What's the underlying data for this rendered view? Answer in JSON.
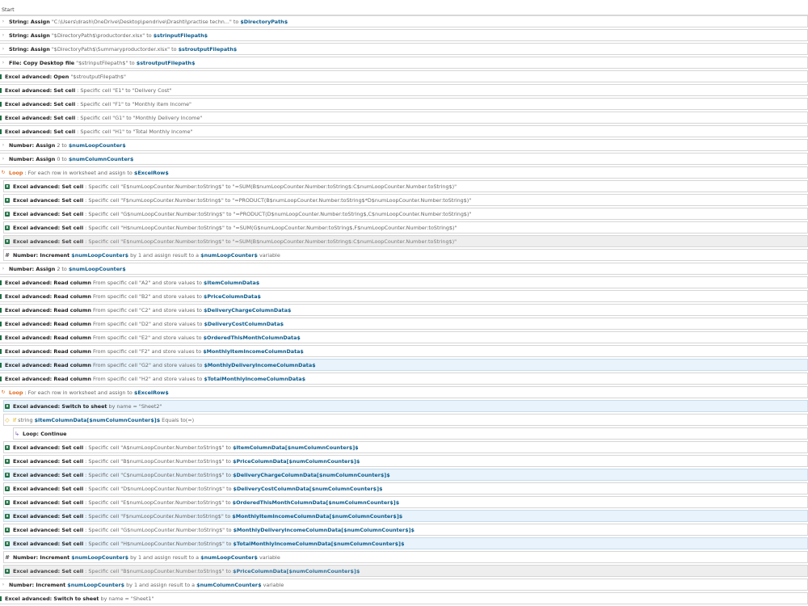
{
  "start_label": "Start",
  "colors": {
    "variable": "#0b5c8e",
    "loop": "#e26a1c",
    "if": "#e0a800",
    "excel_icon": "#1d6f42",
    "selected_row": "#e8f3fb",
    "disabled_row": "#eeeeee"
  },
  "steps": [
    {
      "indent": 0,
      "icon": "assign-icon",
      "segs": [
        [
          "a",
          "String: Assign"
        ],
        [
          "k",
          " \"C:\\Users\\drash\\OneDrive\\Desktop\\pendrive\\Drashti\\practise techn...\" to "
        ],
        [
          "v",
          "$DirectoryPath$"
        ]
      ]
    },
    {
      "indent": 0,
      "icon": "assign-icon",
      "segs": [
        [
          "a",
          "String: Assign"
        ],
        [
          "k",
          " \"$DirectoryPath$\\productorder.xlsx\" to "
        ],
        [
          "v",
          "$strinputFilepath$"
        ]
      ]
    },
    {
      "indent": 0,
      "icon": "assign-icon",
      "segs": [
        [
          "a",
          "String: Assign"
        ],
        [
          "k",
          " \"$DirectoryPath$\\Summaryproductorder.xlsx\" to "
        ],
        [
          "v",
          "$stroutputFilepath$"
        ]
      ]
    },
    {
      "indent": 0,
      "icon": "file-icon",
      "segs": [
        [
          "a",
          "File: Copy Desktop file"
        ],
        [
          "k",
          " \"$strinputFilepath$\" to "
        ],
        [
          "v",
          "$stroutputFilepath$"
        ]
      ]
    },
    {
      "indent": 0,
      "icon": "excel-icon",
      "segs": [
        [
          "a",
          "Excel advanced: Open"
        ],
        [
          "k",
          " \"$stroutputFilepath$\""
        ]
      ]
    },
    {
      "indent": 0,
      "icon": "excel-icon",
      "segs": [
        [
          "a",
          "Excel advanced: Set cell"
        ],
        [
          "k",
          " : Specific cell \"E1\" to \"Delivery Cost\""
        ]
      ]
    },
    {
      "indent": 0,
      "icon": "excel-icon",
      "segs": [
        [
          "a",
          "Excel advanced: Set cell"
        ],
        [
          "k",
          " : Specific cell \"F1\" to \"Monthly Item Income\""
        ]
      ]
    },
    {
      "indent": 0,
      "icon": "excel-icon",
      "segs": [
        [
          "a",
          "Excel advanced: Set cell"
        ],
        [
          "k",
          " : Specific cell \"G1\" to \"Monthly Delivery Income\""
        ]
      ]
    },
    {
      "indent": 0,
      "icon": "excel-icon",
      "segs": [
        [
          "a",
          "Excel advanced: Set cell"
        ],
        [
          "k",
          " : Specific cell \"H1\" to \"Total Monthly Income\""
        ]
      ]
    },
    {
      "indent": 0,
      "icon": "number-icon",
      "segs": [
        [
          "a",
          "Number: Assign"
        ],
        [
          "k",
          " 2 to "
        ],
        [
          "v",
          "$numLoopCounter$"
        ]
      ]
    },
    {
      "indent": 0,
      "icon": "number-icon",
      "segs": [
        [
          "a",
          "Number: Assign"
        ],
        [
          "k",
          " 0 to "
        ],
        [
          "v",
          "$numColumnCounter$"
        ]
      ]
    },
    {
      "indent": 0,
      "icon": "loop-icon",
      "segs": [
        [
          "l",
          "Loop"
        ],
        [
          "k",
          " : For each row in worksheet and assign to "
        ],
        [
          "v",
          "$ExcelRow$"
        ]
      ]
    },
    {
      "indent": 1,
      "icon": "excel-icon",
      "segs": [
        [
          "a",
          "Excel advanced: Set cell"
        ],
        [
          "k",
          " : Specific cell \"E$numLoopCounter.Number:toString$\" to \"=SUM(B$numLoopCounter.Number:toString$:C$numLoopCounter.Number:toString$)\""
        ]
      ]
    },
    {
      "indent": 1,
      "icon": "excel-icon",
      "segs": [
        [
          "a",
          "Excel advanced: Set cell"
        ],
        [
          "k",
          " : Specific cell \"F$numLoopCounter.Number:toString$\" to \"=PRODUCT(B$numLoopCounter.Number:toString$*D$numLoopCounter.Number:toString$)\""
        ]
      ]
    },
    {
      "indent": 1,
      "icon": "excel-icon",
      "segs": [
        [
          "a",
          "Excel advanced: Set cell"
        ],
        [
          "k",
          " : Specific cell \"G$numLoopCounter.Number:toString$\" to \"=PRODUCT(D$numLoopCounter.Number:toString$,C$numLoopCounter.Number:toString$)\""
        ]
      ]
    },
    {
      "indent": 1,
      "icon": "excel-icon",
      "segs": [
        [
          "a",
          "Excel advanced: Set cell"
        ],
        [
          "k",
          " : Specific cell \"H$numLoopCounter.Number:toString$\" to \"=SUM(G$numLoopCounter.Number:toString$,F$numLoopCounter.Number:toString$)\""
        ]
      ]
    },
    {
      "indent": 1,
      "icon": "excel-icon",
      "state": "dis",
      "segs": [
        [
          "a",
          "Excel advanced: Set cell"
        ],
        [
          "k",
          " : Specific cell \"E$numLoopCounter.Number:toString$\" to \"=SUM(B$numLoopCounter.Number:toString$:C$numLoopCounter.Number:toString$)\""
        ]
      ]
    },
    {
      "indent": 1,
      "icon": "hash-icon",
      "segs": [
        [
          "a",
          "Number: Increment"
        ],
        [
          "k",
          " "
        ],
        [
          "v",
          "$numLoopCounter$"
        ],
        [
          "k",
          " by 1 and assign result to a "
        ],
        [
          "v",
          "$numLoopCounter$"
        ],
        [
          "k",
          " variable"
        ]
      ]
    },
    {
      "indent": 0,
      "icon": "number-icon",
      "segs": [
        [
          "a",
          "Number: Assign"
        ],
        [
          "k",
          " 2 to "
        ],
        [
          "v",
          "$numLoopCounter$"
        ]
      ]
    },
    {
      "indent": 0,
      "icon": "excel-icon",
      "segs": [
        [
          "a",
          "Excel advanced: Read column"
        ],
        [
          "k",
          " From specific cell \"A2\" and store values to "
        ],
        [
          "v",
          "$ItemColumnData$"
        ]
      ]
    },
    {
      "indent": 0,
      "icon": "excel-icon",
      "segs": [
        [
          "a",
          "Excel advanced: Read column"
        ],
        [
          "k",
          " From specific cell \"B2\" and store values to "
        ],
        [
          "v",
          "$PriceColumnData$"
        ]
      ]
    },
    {
      "indent": 0,
      "icon": "excel-icon",
      "segs": [
        [
          "a",
          "Excel advanced: Read column"
        ],
        [
          "k",
          " From specific cell \"C2\" and store values to "
        ],
        [
          "v",
          "$DeliveryChargeColumnData$"
        ]
      ]
    },
    {
      "indent": 0,
      "icon": "excel-icon",
      "segs": [
        [
          "a",
          "Excel advanced: Read column"
        ],
        [
          "k",
          " From specific cell \"D2\" and store values to "
        ],
        [
          "v",
          "$DeliveryCostColumnData$"
        ]
      ]
    },
    {
      "indent": 0,
      "icon": "excel-icon",
      "segs": [
        [
          "a",
          "Excel advanced: Read column"
        ],
        [
          "k",
          " From specific cell \"E2\" and store values to "
        ],
        [
          "v",
          "$OrderedThisMonthColumnData$"
        ]
      ]
    },
    {
      "indent": 0,
      "icon": "excel-icon",
      "segs": [
        [
          "a",
          "Excel advanced: Read column"
        ],
        [
          "k",
          " From specific cell \"F2\" and store values to "
        ],
        [
          "v",
          "$MonthlyItemIncomeColumnData$"
        ]
      ]
    },
    {
      "indent": 0,
      "icon": "excel-icon",
      "state": "sel",
      "segs": [
        [
          "a",
          "Excel advanced: Read column"
        ],
        [
          "k",
          " From specific cell \"G2\" and store values to "
        ],
        [
          "v",
          "$MonthlyDeliveryIncomeColumnData$"
        ]
      ]
    },
    {
      "indent": 0,
      "icon": "excel-icon",
      "segs": [
        [
          "a",
          "Excel advanced: Read column"
        ],
        [
          "k",
          " From specific cell \"H2\" and store values to "
        ],
        [
          "v",
          "$TotalMonthlyIncomeColumnData$"
        ]
      ]
    },
    {
      "indent": 0,
      "icon": "loop-icon",
      "segs": [
        [
          "l",
          "Loop"
        ],
        [
          "k",
          " : For each row in worksheet and assign to "
        ],
        [
          "v",
          "$ExcelRow$"
        ]
      ]
    },
    {
      "indent": 1,
      "icon": "excel-icon",
      "state": "sel",
      "segs": [
        [
          "a",
          "Excel advanced: Switch to sheet"
        ],
        [
          "k",
          " by name = \"Sheet2\""
        ]
      ]
    },
    {
      "indent": 1,
      "icon": "if-icon",
      "segs": [
        [
          "i",
          "If"
        ],
        [
          "k",
          " string "
        ],
        [
          "v",
          "$ItemColumnData[$numColumnCounter$]$"
        ],
        [
          "k",
          " Equals to(=)"
        ]
      ]
    },
    {
      "indent": 2,
      "icon": "continue-icon",
      "segs": [
        [
          "a",
          "Loop: Continue"
        ]
      ]
    },
    {
      "indent": 1,
      "icon": "excel-icon",
      "segs": [
        [
          "a",
          "Excel advanced: Set cell"
        ],
        [
          "k",
          " : Specific cell \"A$numLoopCounter.Number:toString$\" to "
        ],
        [
          "v",
          "$ItemColumnData[$numColumnCounter$]$"
        ]
      ]
    },
    {
      "indent": 1,
      "icon": "excel-icon",
      "segs": [
        [
          "a",
          "Excel advanced: Set cell"
        ],
        [
          "k",
          " : Specific cell \"B$numLoopCounter.Number:toString$\" to "
        ],
        [
          "v",
          "$PriceColumnData[$numColumnCounter$]$"
        ]
      ]
    },
    {
      "indent": 1,
      "icon": "excel-icon",
      "state": "sel",
      "segs": [
        [
          "a",
          "Excel advanced: Set cell"
        ],
        [
          "k",
          " : Specific cell \"C$numLoopCounter.Number:toString$\" to "
        ],
        [
          "v",
          "$DeliveryChargeColumnData[$numColumnCounter$]$"
        ]
      ]
    },
    {
      "indent": 1,
      "icon": "excel-icon",
      "segs": [
        [
          "a",
          "Excel advanced: Set cell"
        ],
        [
          "k",
          " : Specific cell \"D$numLoopCounter.Number:toString$\" to "
        ],
        [
          "v",
          "$DeliveryCostColumnData[$numColumnCounter$]$"
        ]
      ]
    },
    {
      "indent": 1,
      "icon": "excel-icon",
      "segs": [
        [
          "a",
          "Excel advanced: Set cell"
        ],
        [
          "k",
          " : Specific cell \"E$numLoopCounter.Number:toString$\" to "
        ],
        [
          "v",
          "$OrderedThisMonthColumnData[$numColumnCounter$]$"
        ]
      ]
    },
    {
      "indent": 1,
      "icon": "excel-icon",
      "state": "sel",
      "segs": [
        [
          "a",
          "Excel advanced: Set cell"
        ],
        [
          "k",
          " : Specific cell \"F$numLoopCounter.Number:toString$\" to "
        ],
        [
          "v",
          "$MonthlyItemIncomeColumnData[$numColumnCounter$]$"
        ]
      ]
    },
    {
      "indent": 1,
      "icon": "excel-icon",
      "segs": [
        [
          "a",
          "Excel advanced: Set cell"
        ],
        [
          "k",
          " : Specific cell \"G$numLoopCounter.Number:toString$\" to "
        ],
        [
          "v",
          "$MonthlyDeliveryIncomeColumnData[$numColumnCounter$]$"
        ]
      ]
    },
    {
      "indent": 1,
      "icon": "excel-icon",
      "state": "sel",
      "segs": [
        [
          "a",
          "Excel advanced: Set cell"
        ],
        [
          "k",
          " : Specific cell \"H$numLoopCounter.Number:toString$\" to "
        ],
        [
          "v",
          "$TotalMonthlyIncomeColumnData[$numColumnCounter$]$"
        ]
      ]
    },
    {
      "indent": 1,
      "icon": "hash-icon",
      "segs": [
        [
          "a",
          "Number: Increment"
        ],
        [
          "k",
          " "
        ],
        [
          "v",
          "$numLoopCounter$"
        ],
        [
          "k",
          " by 1 and assign result to a "
        ],
        [
          "v",
          "$numLoopCounter$"
        ],
        [
          "k",
          " variable"
        ]
      ]
    },
    {
      "indent": 1,
      "icon": "excel-icon",
      "state": "dis",
      "segs": [
        [
          "a",
          "Excel advanced: Set cell"
        ],
        [
          "k",
          " : Specific cell \"B$numLoopCounter.Number:toString$\" to "
        ],
        [
          "v",
          "$PriceColumnData[$numColumnCounter$]$"
        ]
      ]
    },
    {
      "indent": 0,
      "icon": "number-icon",
      "segs": [
        [
          "a",
          "Number: Increment"
        ],
        [
          "k",
          " "
        ],
        [
          "v",
          "$numLoopCounter$"
        ],
        [
          "k",
          " by 1 and assign result to a "
        ],
        [
          "v",
          "$numColumnCounter$"
        ],
        [
          "k",
          " variable"
        ]
      ]
    },
    {
      "indent": 0,
      "icon": "excel-icon",
      "segs": [
        [
          "a",
          "Excel advanced: Switch to sheet"
        ],
        [
          "k",
          " by name = \"Sheet1\""
        ]
      ]
    }
  ]
}
